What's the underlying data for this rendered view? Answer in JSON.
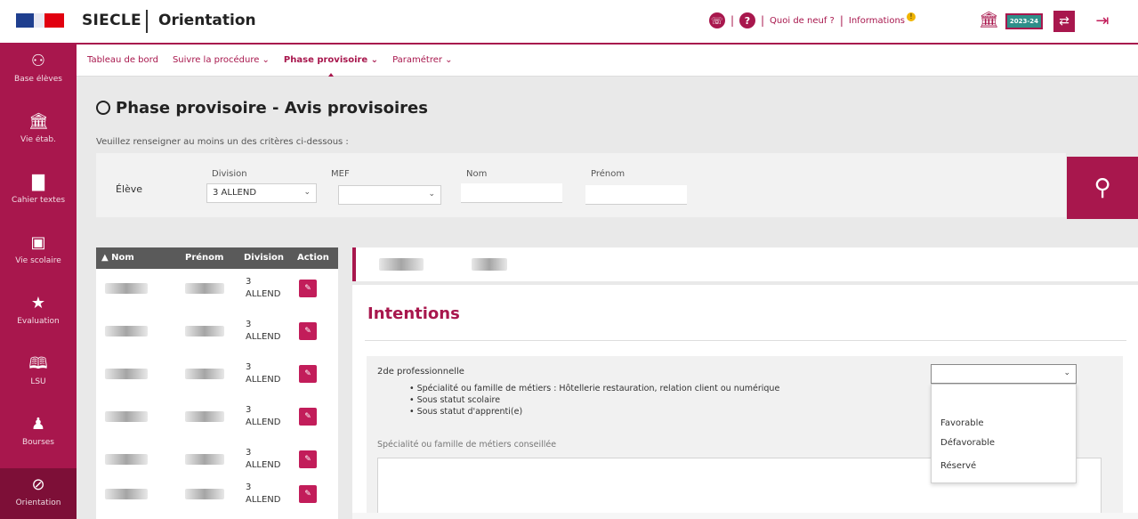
{
  "header": {
    "app_name": "SIECLE",
    "app_sub": "Orientation",
    "quoi_de_neuf": "Quoi de neuf ?",
    "informations": "Informations",
    "year_label": "2023-24"
  },
  "sidebar": {
    "items": [
      {
        "label": "Base élèves",
        "icon": "users-icon"
      },
      {
        "label": "Vie étab.",
        "icon": "building-icon"
      },
      {
        "label": "Cahier textes",
        "icon": "book-icon"
      },
      {
        "label": "Vie scolaire",
        "icon": "calendar-icon"
      },
      {
        "label": "Évaluation",
        "icon": "star-icon"
      },
      {
        "label": "LSU",
        "icon": "open-book-icon"
      },
      {
        "label": "Bourses",
        "icon": "person-icon"
      },
      {
        "label": "Orientation",
        "icon": "compass-icon"
      }
    ]
  },
  "subnav": {
    "items": [
      "Tableau de bord",
      "Suivre la procédure ⌄",
      "Phase provisoire ⌄",
      "Paramétrer ⌄"
    ],
    "active_index": 2
  },
  "page": {
    "title": "Phase provisoire - Avis provisoires",
    "instructions": "Veuillez renseigner au moins un des critères ci-dessous :"
  },
  "filter": {
    "eleve_label": "Élève",
    "division_label": "Division",
    "division_value": "3 ALLEND",
    "mef_label": "MEF",
    "mef_value": "",
    "nom_label": "Nom",
    "prenom_label": "Prénom"
  },
  "table": {
    "headers": [
      "▲ Nom",
      "Prénom",
      "Division",
      "Action"
    ],
    "rows": [
      {
        "division_a": "3",
        "division_b": "ALLEND"
      },
      {
        "division_a": "3",
        "division_b": "ALLEND"
      },
      {
        "division_a": "3",
        "division_b": "ALLEND"
      },
      {
        "division_a": "3",
        "division_b": "ALLEND"
      },
      {
        "division_a": "3",
        "division_b": "ALLEND"
      },
      {
        "division_a": "3",
        "division_b": "ALLEND"
      }
    ]
  },
  "intentions": {
    "title": "Intentions",
    "voeu_title": "2de professionnelle",
    "bullets": [
      "• Spécialité ou famille de métiers : Hôtellerie restauration, relation client ou numérique",
      "• Sous statut scolaire",
      "• Sous statut d'apprenti(e)"
    ],
    "spec_label": "Spécialité ou famille de métiers conseillée",
    "dropdown_value": "",
    "dropdown_options": [
      "Favorable",
      "Défavorable",
      "Réservé"
    ]
  }
}
